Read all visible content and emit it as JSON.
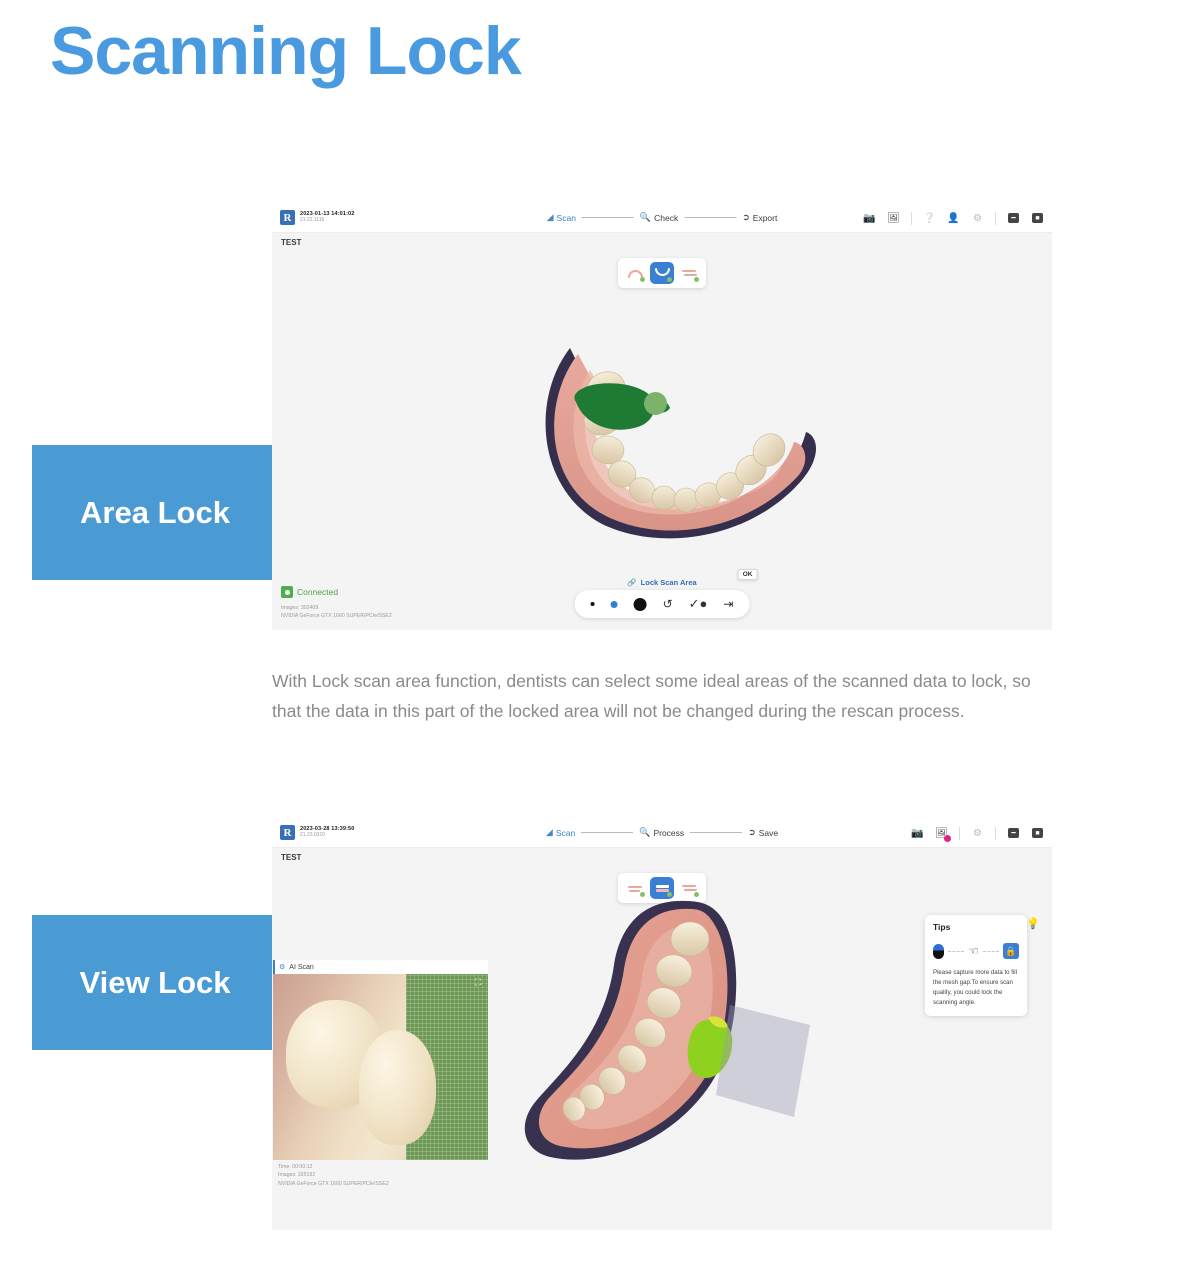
{
  "page": {
    "title": "Scanning Lock",
    "accent_blue": "#4a9ae0",
    "label_blue": "#4a9ad4"
  },
  "sections": [
    {
      "label": "Area Lock",
      "paragraph": "With Lock scan area function, dentists can select some ideal areas of the scanned data to lock, so that the data in this part of the locked area will not be changed during the rescan process."
    },
    {
      "label": "View Lock"
    }
  ],
  "shot1": {
    "titlebar": {
      "logo": "R",
      "date": "2023-01-13 14:01:02",
      "version": "21.22.1116",
      "steps": [
        {
          "label": "Scan",
          "icon": "scan-icon",
          "active": true
        },
        {
          "label": "Check",
          "icon": "check-magnifier-icon",
          "active": false
        },
        {
          "label": "Export",
          "icon": "export-icon",
          "active": false
        }
      ],
      "icons": [
        "camera-icon",
        "image-icon",
        "help-icon",
        "user-icon",
        "gear-icon",
        "minimize-icon",
        "close-icon"
      ]
    },
    "subbar": {
      "case_name": "TEST"
    },
    "view_toggle": [
      {
        "name": "upper-jaw",
        "active": false
      },
      {
        "name": "lower-jaw",
        "active": true
      },
      {
        "name": "bite",
        "active": false
      }
    ],
    "status": {
      "connected": "Connected",
      "images": "Images: 302409",
      "gpu": "NVIDIA GeForce GTX 1660 SUPER/PCIe/SSE2"
    },
    "lock_bar": {
      "label": "Lock Scan Area",
      "tooltip": "OK",
      "tools": [
        "brush-size-xs",
        "brush-size-s",
        "brush-size-l",
        "undo-icon",
        "confirm-icon",
        "exit-icon"
      ]
    }
  },
  "shot2": {
    "titlebar": {
      "logo": "R",
      "date": "2023-03-28 13:39:50",
      "version": "21.23.0310",
      "steps": [
        {
          "label": "Scan",
          "icon": "scan-icon",
          "active": true
        },
        {
          "label": "Process",
          "icon": "process-magnifier-icon",
          "active": false
        },
        {
          "label": "Save",
          "icon": "save-icon",
          "active": false
        }
      ],
      "icons": [
        "camera-icon",
        "image-icon",
        "gear-icon",
        "minimize-icon",
        "close-icon"
      ],
      "image_icon_badge": "#e0218a"
    },
    "subbar": {
      "case_name": "TEST"
    },
    "view_toggle": [
      {
        "name": "upper-jaw",
        "active": false
      },
      {
        "name": "lower-jaw",
        "active": true
      },
      {
        "name": "bite",
        "active": false
      }
    ],
    "tips": {
      "title": "Tips",
      "text": "Please capture more data to fill the mesh gap.To ensure scan quality, you could lock the scanning angle.",
      "icons": [
        "mouse-icon",
        "hand-drag-icon",
        "lock-angle-icon"
      ],
      "bulb": "bulb-icon"
    },
    "ai_panel": {
      "title": "AI Scan",
      "time": "Time: 00:00:12",
      "images": "Images: 325192",
      "gpu": "NVIDIA GeForce GTX 1660 SUPER/PCIe/SSE2"
    }
  }
}
